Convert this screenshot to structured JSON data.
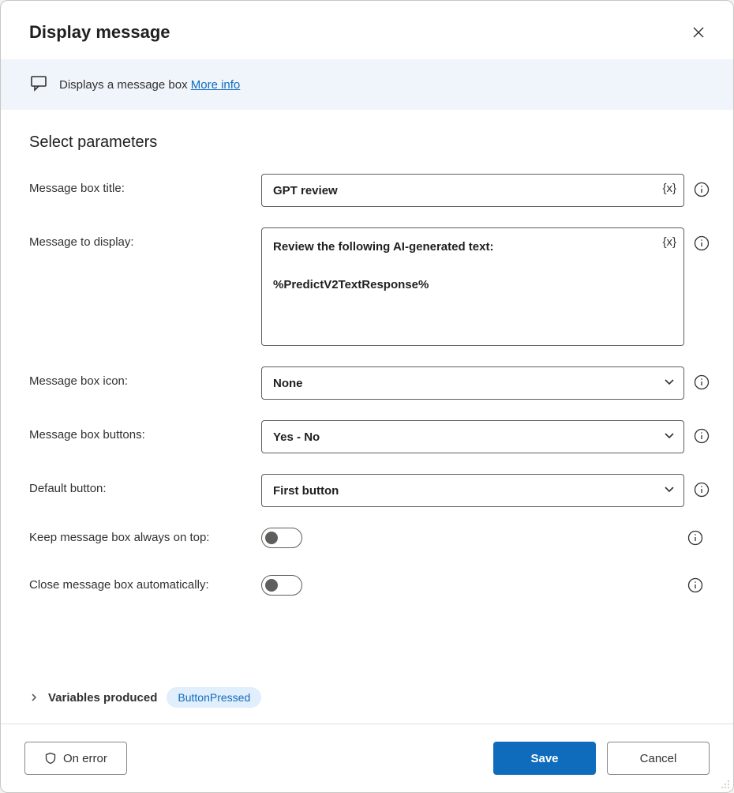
{
  "header": {
    "title": "Display message"
  },
  "description": {
    "text": "Displays a message box ",
    "link_label": "More info"
  },
  "section": {
    "title": "Select parameters"
  },
  "fields": {
    "title": {
      "label": "Message box title:",
      "value": "GPT review",
      "var_token": "{x}"
    },
    "message": {
      "label": "Message to display:",
      "value": "Review the following AI-generated text:\n\n%PredictV2TextResponse%",
      "var_token": "{x}"
    },
    "icon": {
      "label": "Message box icon:",
      "value": "None"
    },
    "buttons": {
      "label": "Message box buttons:",
      "value": "Yes - No"
    },
    "default_button": {
      "label": "Default button:",
      "value": "First button"
    },
    "always_on_top": {
      "label": "Keep message box always on top:",
      "value": false
    },
    "auto_close": {
      "label": "Close message box automatically:",
      "value": false
    }
  },
  "variables_produced": {
    "label": "Variables produced",
    "items": [
      "ButtonPressed"
    ]
  },
  "footer": {
    "on_error": "On error",
    "save": "Save",
    "cancel": "Cancel"
  }
}
